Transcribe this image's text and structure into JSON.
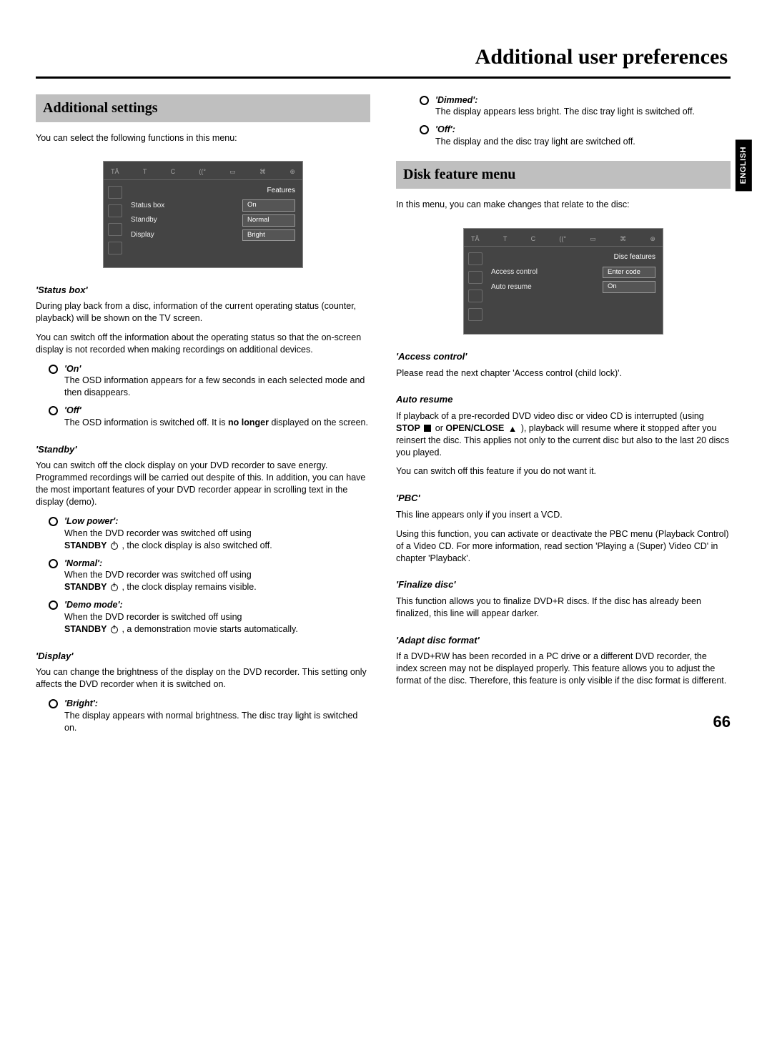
{
  "page_title": "Additional user preferences",
  "language_tab": "ENGLISH",
  "page_number": "66",
  "left": {
    "section_heading": "Additional settings",
    "intro": "You can select the following functions in this menu:",
    "osd": {
      "title": "Features",
      "rows": [
        {
          "label": "Status box",
          "value": "On"
        },
        {
          "label": "Standby",
          "value": "Normal"
        },
        {
          "label": "Display",
          "value": "Bright"
        }
      ]
    },
    "status_box": {
      "heading": "'Status box'",
      "para1": "During play back from a disc, information of the current operating status (counter, playback) will be shown on the TV screen.",
      "para2": "You can switch off the information about the operating status so that the on-screen display is not recorded when making recordings on additional devices.",
      "items": [
        {
          "title": "'On'",
          "desc": "The OSD information appears for a few seconds in each selected mode and then disappears."
        },
        {
          "title": "'Off'",
          "desc_pre": "The OSD information is switched off. It is ",
          "bold": "no longer",
          "desc_post": " displayed on the screen."
        }
      ]
    },
    "standby": {
      "heading": "'Standby'",
      "para": "You can switch off the clock display on your DVD recorder to save energy. Programmed recordings will be carried out despite of this. In addition, you can have the most important features of your DVD recorder appear in scrolling text in the display (demo).",
      "items": [
        {
          "title": "'Low power':",
          "l1": "When the DVD recorder was switched off using",
          "l2a": "STANDBY",
          "l2b": " , the clock display is also switched off."
        },
        {
          "title": "'Normal':",
          "l1": "When the DVD recorder was switched off using",
          "l2a": "STANDBY",
          "l2b": " , the clock display remains visible."
        },
        {
          "title": "'Demo mode':",
          "l1": "When the DVD recorder is switched off using",
          "l2a": "STANDBY",
          "l2b": " , a demonstration movie starts automatically."
        }
      ]
    },
    "display": {
      "heading": "'Display'",
      "para": "You can change the brightness of the display on the DVD recorder. This setting only affects the DVD recorder when it is switched on.",
      "items": [
        {
          "title": "'Bright':",
          "desc": "The display appears with normal brightness. The disc tray light is switched on."
        }
      ]
    }
  },
  "right": {
    "display_cont": [
      {
        "title": "'Dimmed':",
        "desc": "The display appears less bright. The disc tray light is switched off."
      },
      {
        "title": "'Off':",
        "desc": "The display and the disc tray light are switched off."
      }
    ],
    "section_heading": "Disk feature menu",
    "intro": "In this menu, you can make changes that relate to the disc:",
    "osd": {
      "title": "Disc features",
      "rows": [
        {
          "label": "Access control",
          "value": "Enter code"
        },
        {
          "label": "Auto resume",
          "value": "On"
        }
      ]
    },
    "access": {
      "heading": "'Access control'",
      "para": "Please read the next chapter 'Access control (child lock)'."
    },
    "auto_resume": {
      "heading": "Auto resume",
      "p1a": "If playback of a pre-recorded DVD video disc or video CD is interrupted (using ",
      "stop": "STOP",
      "or": " or ",
      "open": " OPEN/CLOSE",
      "p1b": " ), playback will resume where it stopped after you reinsert the disc. This applies not only to the current disc but also to the last 20 discs you played.",
      "p2": "You can switch off this feature if you do not want it."
    },
    "pbc": {
      "heading": "'PBC'",
      "p1": "This line appears only if you insert a VCD.",
      "p2": "Using this function, you can activate or deactivate the PBC menu (Playback Control) of a Video CD. For more information, read section 'Playing a (Super) Video CD' in chapter 'Playback'."
    },
    "finalize": {
      "heading": "'Finalize disc'",
      "p": "This function allows you to finalize DVD+R discs. If the disc has already been finalized, this line will appear darker."
    },
    "adapt": {
      "heading": "'Adapt disc format'",
      "p": "If a DVD+RW has been recorded in a PC drive or a different DVD recorder, the index screen may not be displayed properly. This feature allows you to adjust the format of the disc. Therefore, this feature is only visible if the disc format is different."
    }
  }
}
